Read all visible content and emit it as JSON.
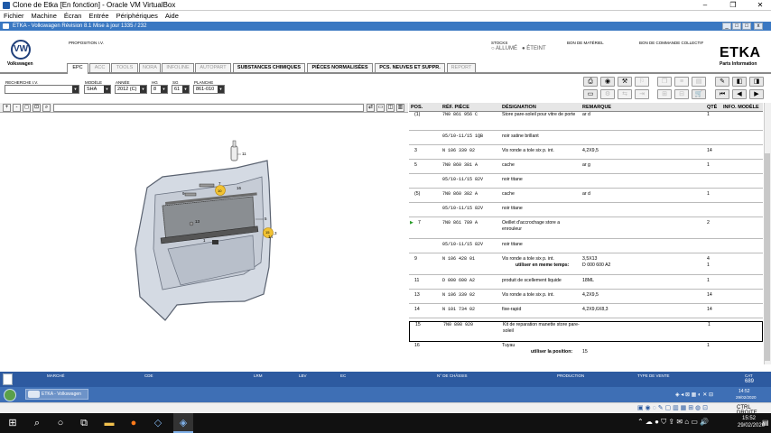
{
  "vbox": {
    "title": "Clone de Etka [En fonction] - Oracle VM VirtualBox",
    "menu": [
      "Fichier",
      "Machine",
      "Écran",
      "Entrée",
      "Périphériques",
      "Aide"
    ],
    "host_key": "CTRL DROITE"
  },
  "etka": {
    "window_title": "ETKA - Volkswagen Révision 8.1 Mise à jour 1335 / 232",
    "brand": "Volkswagen",
    "proposition": "PROPOSITION I.V.",
    "stocks_label": "STOCKS",
    "stock_options": [
      "ALLUMÉ",
      "ÉTEINT"
    ],
    "bank_label": "BON DE MATÉRIEL",
    "collective_label": "BON DE COMMANDE COLLECTIF",
    "logo": "ETKA",
    "logo_sub": "Parts Information",
    "tabs": [
      "EPC",
      "ACC",
      "TOOLS",
      "NORA",
      "INFOLINE",
      "AUTOPART",
      "SUBSTANCES CHIMIQUES",
      "PIÈCES NORMALISÉES",
      "PCS. NEUVES ET SUPPR.",
      "REPORT"
    ],
    "filters": {
      "search_label": "RECHERCHE I.V.",
      "model_label": "MODÈLE",
      "model": "SHA",
      "year_label": "ANNÉE",
      "year": "2012 (C)",
      "hg_label": "HG",
      "hg": "8",
      "sg_label": "SG",
      "sg": "61",
      "plate_label": "PLANCHE",
      "plate": "861-010"
    },
    "table": {
      "headers": {
        "pos": "POS.",
        "ref": "RÉF. PIÈCE",
        "des": "DÉSIGNATION",
        "rem": "REMARQUE",
        "qty": "QTÉ",
        "info": "INFO. MODÈLE"
      },
      "rows": [
        {
          "pos": "(1)",
          "ref": "7N0  861  956  C",
          "des": "Store pare-soleil pour vitre de porte",
          "rem": "ar d",
          "qty": "1"
        },
        {
          "pos": "",
          "ref": "05/10-11/15  1QB",
          "des": "noir satine brillant",
          "rem": "",
          "qty": ""
        },
        {
          "pos": "3",
          "ref": "N    106  339  02",
          "des": "Vis ronde a tole six p. int.",
          "rem": "4,2X9,5",
          "qty": "14"
        },
        {
          "pos": "5",
          "ref": "7N0  860  381  A",
          "des": "cache",
          "rem": "ar g",
          "qty": "1"
        },
        {
          "pos": "",
          "ref": "05/10-11/15  82V",
          "des": "noir titane",
          "rem": "",
          "qty": ""
        },
        {
          "pos": "(5)",
          "ref": "7N0  860  382  A",
          "des": "cache",
          "rem": "ar d",
          "qty": "1"
        },
        {
          "pos": "",
          "ref": "05/10-11/15  82V",
          "des": "noir titane",
          "rem": "",
          "qty": ""
        },
        {
          "pos": "7",
          "ref": "7N0  861  789  A",
          "des": "Oeillet d'accrochage store a enrouleur",
          "rem": "",
          "qty": "2"
        },
        {
          "pos": "",
          "ref": "05/10-11/15  82V",
          "des": "noir titane",
          "rem": "",
          "qty": ""
        },
        {
          "pos": "9",
          "ref": "N    106  428  01",
          "des": "Vis ronde a tole six p. int.",
          "rem": "3,5X13",
          "qty": "4",
          "sub_label": "utiliser en meme temps:",
          "sub_rem": "D   000 600 A2",
          "sub_qty": "1"
        },
        {
          "pos": "11",
          "ref": "D    000  600  A2",
          "des": "produit de scellement liquide",
          "rem": "18ML",
          "qty": "1"
        },
        {
          "pos": "13",
          "ref": "N    106  339  02",
          "des": "Vis ronde a tole six p. int.",
          "rem": "4,2X9,5",
          "qty": "14"
        },
        {
          "pos": "14",
          "ref": "N    101  734  02",
          "des": "fixe-rapid",
          "rem": "4,2X9,6X8,3",
          "qty": "14"
        },
        {
          "pos": "15",
          "ref": "7N0  898  920",
          "des": "Kit de reparation manette store pare-soleil",
          "rem": "",
          "qty": "1"
        },
        {
          "pos": "16",
          "ref": "",
          "des": "Tuyau",
          "rem": "",
          "qty": "1",
          "sub_label": "utiliser la position:",
          "sub_rem": "15"
        }
      ]
    },
    "diagram_labels": [
      "11",
      "7",
      "16",
      "9",
      "10",
      "13",
      "5",
      "14",
      "15",
      "1",
      "3"
    ],
    "status": {
      "market": "MARCHÉ",
      "code": "CDE",
      "lrm": "LRM",
      "lbv": "LBV",
      "ec": "EC",
      "chassis": "N° DE CHÂSSIS",
      "production": "PRODUCTION",
      "sale_type": "TYPE DE VENTE",
      "cat_label": "CAT",
      "cat": "689"
    },
    "taskbar_button": "ETKA - Volkswagen",
    "guest_clock": {
      "time": "14:52",
      "date": "29/02/2020"
    }
  },
  "host_clock": {
    "time": "15:52",
    "date": "29/02/2020"
  }
}
